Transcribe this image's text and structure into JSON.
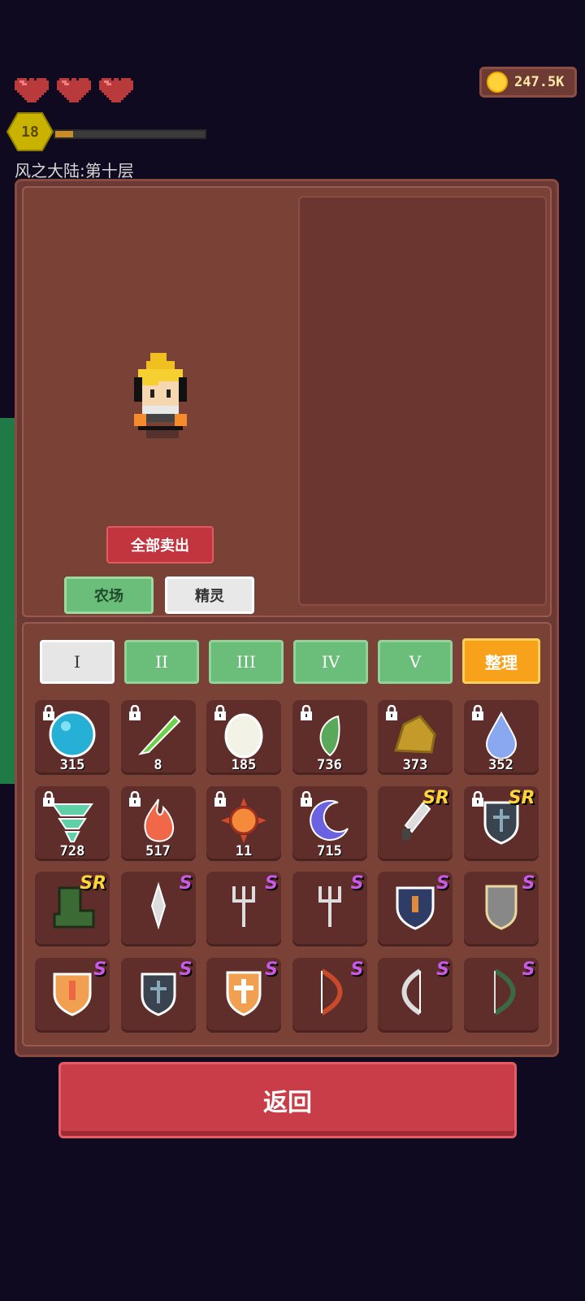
{
  "hud": {
    "hearts": 3,
    "coins": "247.5K",
    "level": "18",
    "xp_fraction": 0.12,
    "location": "风之大陆:第十层"
  },
  "actions": {
    "sell_all": "全部卖出",
    "farm": "农场",
    "spirit": "精灵"
  },
  "tabs": [
    "I",
    "II",
    "III",
    "IV",
    "V"
  ],
  "active_tab_index": 0,
  "sort_label": "整理",
  "items": [
    {
      "name": "blue-orb-icon",
      "count": "315",
      "locked": true,
      "rank": ""
    },
    {
      "name": "green-leaf-icon",
      "count": "8",
      "locked": true,
      "rank": ""
    },
    {
      "name": "egg-icon",
      "count": "185",
      "locked": true,
      "rank": ""
    },
    {
      "name": "herb-icon",
      "count": "736",
      "locked": true,
      "rank": ""
    },
    {
      "name": "gold-ore-icon",
      "count": "373",
      "locked": true,
      "rank": ""
    },
    {
      "name": "water-drop-icon",
      "count": "352",
      "locked": true,
      "rank": ""
    },
    {
      "name": "tornado-icon",
      "count": "728",
      "locked": true,
      "rank": ""
    },
    {
      "name": "fire-icon",
      "count": "517",
      "locked": true,
      "rank": ""
    },
    {
      "name": "sun-icon",
      "count": "11",
      "locked": true,
      "rank": ""
    },
    {
      "name": "moon-icon",
      "count": "715",
      "locked": true,
      "rank": ""
    },
    {
      "name": "dagger-icon",
      "count": "",
      "locked": false,
      "rank": "SR"
    },
    {
      "name": "dark-shield-icon",
      "count": "",
      "locked": true,
      "rank": "SR"
    },
    {
      "name": "green-boot-icon",
      "count": "",
      "locked": false,
      "rank": "SR"
    },
    {
      "name": "knife-icon",
      "count": "",
      "locked": false,
      "rank": "S"
    },
    {
      "name": "fork-icon",
      "count": "",
      "locked": false,
      "rank": "S"
    },
    {
      "name": "fork-icon",
      "count": "",
      "locked": false,
      "rank": "S"
    },
    {
      "name": "blue-shield-icon",
      "count": "",
      "locked": false,
      "rank": "S"
    },
    {
      "name": "gray-shield-icon",
      "count": "",
      "locked": false,
      "rank": "S"
    },
    {
      "name": "orange-shield-icon",
      "count": "",
      "locked": false,
      "rank": "S"
    },
    {
      "name": "dark-shield-icon",
      "count": "",
      "locked": false,
      "rank": "S"
    },
    {
      "name": "cross-shield-icon",
      "count": "",
      "locked": false,
      "rank": "S"
    },
    {
      "name": "red-bow-icon",
      "count": "",
      "locked": false,
      "rank": "S"
    },
    {
      "name": "bone-bow-icon",
      "count": "",
      "locked": false,
      "rank": "S"
    },
    {
      "name": "green-bow-icon",
      "count": "",
      "locked": false,
      "rank": "S"
    }
  ],
  "back_label": "返回"
}
